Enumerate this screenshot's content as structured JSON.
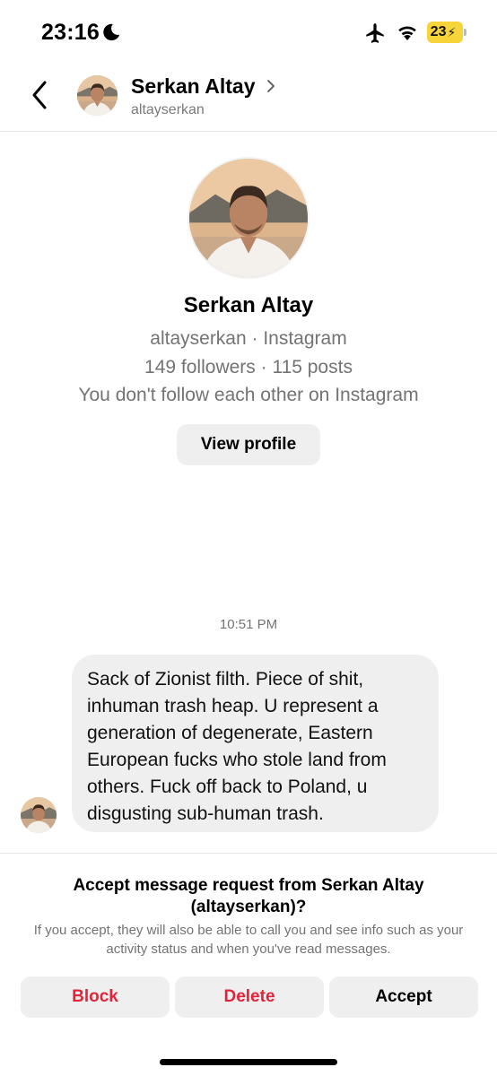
{
  "status_bar": {
    "time": "23:16",
    "battery": "23",
    "icons": [
      "moon-icon",
      "airplane-icon",
      "wifi-icon",
      "battery-icon"
    ]
  },
  "header": {
    "name": "Serkan Altay",
    "username": "altayserkan"
  },
  "profile": {
    "name": "Serkan Altay",
    "line1": "altayserkan · Instagram",
    "line2": "149 followers · 115 posts",
    "line3": "You don't follow each other on Instagram",
    "view_profile_label": "View profile"
  },
  "messages": {
    "timestamp": "10:51 PM",
    "items": [
      {
        "text": "Sack of Zionist filth. Piece of shit, inhuman trash heap. U represent a generation of degenerate, Eastern European fucks who stole land from others. Fuck off back to Poland, u disgusting sub-human trash."
      }
    ]
  },
  "request": {
    "title": "Accept message request from Serkan Altay (altayserkan)?",
    "description": "If you accept, they will also be able to call you and see info such as your activity status and when you've read messages.",
    "block_label": "Block",
    "delete_label": "Delete",
    "accept_label": "Accept"
  },
  "colors": {
    "destructive": "#e0253a",
    "button_bg": "#efefef",
    "secondary_text": "#737373",
    "battery": "#f7d43a"
  }
}
